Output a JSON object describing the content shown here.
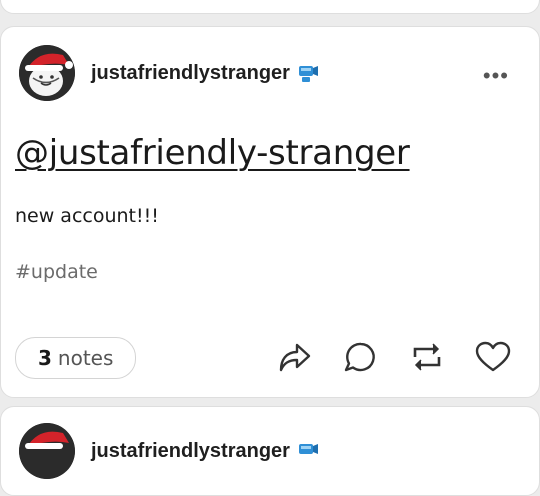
{
  "post": {
    "username": "justafriendlystranger",
    "title": "@justafriendly-stranger",
    "body": "new account!!!",
    "tag": "#update",
    "notes_count": "3",
    "notes_label": "notes",
    "more_label": "•••"
  },
  "next_post": {
    "username": "justafriendlystranger"
  },
  "colors": {
    "background": "#ececec",
    "card": "#ffffff",
    "text": "#1a1a1a",
    "muted": "#6b6b6b",
    "badge": "#2f8fd6",
    "santa_hat": "#d3232a"
  },
  "icons": [
    "share-icon",
    "reply-icon",
    "reblog-icon",
    "like-icon",
    "more-icon",
    "verified-badge-icon"
  ]
}
